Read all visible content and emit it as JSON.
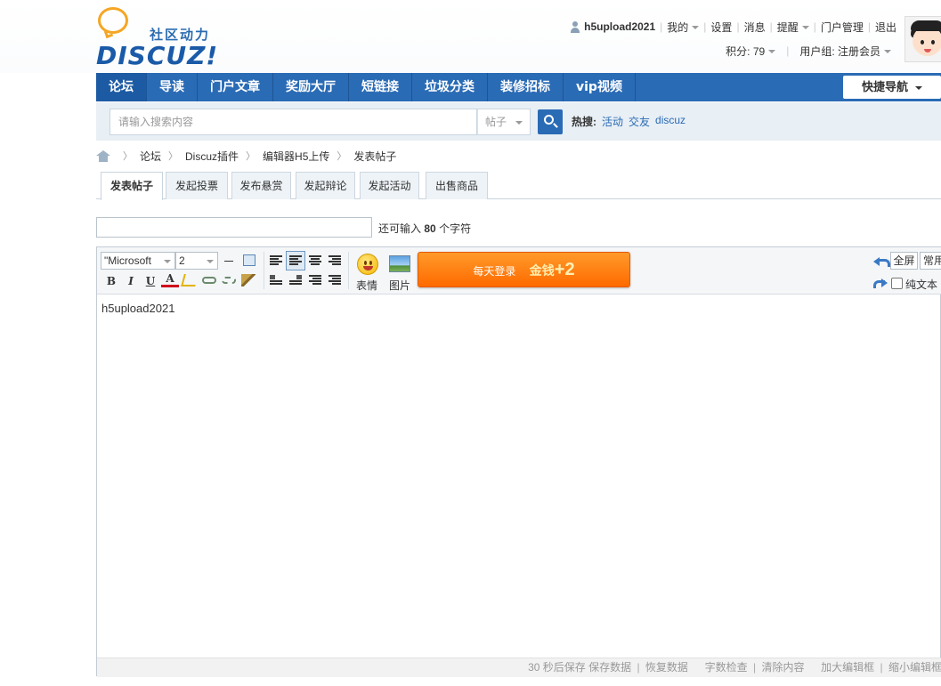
{
  "logo": {
    "slogan": "社区动力",
    "brand": "DISCUZ!"
  },
  "user": {
    "name": "h5upload2021",
    "menu": [
      "我的",
      "设置",
      "消息",
      "提醒",
      "门户管理",
      "退出"
    ],
    "points_label": "积分: 79",
    "group_label": "用户组: 注册会员"
  },
  "nav": {
    "items": [
      "论坛",
      "导读",
      "门户文章",
      "奖励大厅",
      "短链接",
      "垃圾分类",
      "装修招标",
      "vip视频"
    ],
    "quick_nav": "快捷导航"
  },
  "search": {
    "placeholder": "请输入搜索内容",
    "type": "帖子",
    "hot_label": "热搜:",
    "hot_links": [
      "活动",
      "交友",
      "discuz"
    ]
  },
  "breadcrumb": [
    "论坛",
    "Discuz插件",
    "编辑器H5上传",
    "发表帖子"
  ],
  "tabs": [
    "发表帖子",
    "发起投票",
    "发布悬赏",
    "发起辩论",
    "发起活动",
    "出售商品"
  ],
  "subject": {
    "hint_prefix": "还可输入",
    "hint_count": "80",
    "hint_suffix": "个字符"
  },
  "editor": {
    "font": "\"Microsoft",
    "size": "2",
    "buttons": {
      "bold": "B",
      "italic": "I",
      "underline": "U",
      "color": "A"
    },
    "emoji_label": "表情",
    "image_label": "图片",
    "promo_text": "每天登录",
    "promo_reward": "金钱",
    "promo_plus": "+2",
    "fullscreen": "全屏",
    "common": "常用",
    "plain_text": "纯文本",
    "content": "h5upload2021"
  },
  "footer": {
    "autosave": "30 秒后保存",
    "save": "保存数据",
    "restore": "恢复数据",
    "wordcheck": "字数检查",
    "clear": "清除内容",
    "enlarge": "加大编辑框",
    "shrink": "缩小编辑框"
  },
  "colors": {
    "nav": "#2a6bb5",
    "promo": "#ff6a00",
    "link": "#2a6bb5"
  }
}
